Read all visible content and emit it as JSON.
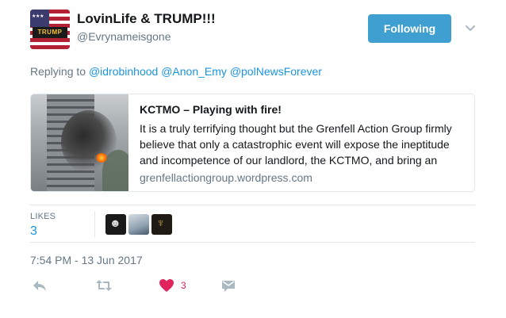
{
  "user": {
    "display_name": "LovinLife & TRUMP!!!",
    "screen_name": "@Evrynameisgone",
    "avatar_text": "TRUMP"
  },
  "follow_button": {
    "label": "Following"
  },
  "reply": {
    "prefix": "Replying to",
    "mentions": [
      "@idrobinhood",
      "@Anon_Emy",
      "@polNewsForever"
    ]
  },
  "card": {
    "title": "KCTMO – Playing with fire!",
    "description": "It is a truly terrifying thought but the Grenfell Action Group firmly believe that only a catastrophic event will expose the ineptitude and incompetence of our landlord, the  KCTMO, and bring an",
    "domain": "grenfellactiongroup.wordpress.com"
  },
  "stats": {
    "likes_label": "LIKES",
    "likes_count": "3"
  },
  "timestamp": "7:54 PM - 13 Jun 2017",
  "actions": {
    "like_count": "3"
  },
  "colors": {
    "accent": "#1b95e0",
    "follow_button_bg": "#3f9fd0",
    "like_red": "#e0245e",
    "muted_text": "#657786",
    "icon_gray": "#aab8c2"
  },
  "icons": [
    "caret-down-icon",
    "reply-icon",
    "retweet-icon",
    "heart-icon",
    "direct-message-icon"
  ]
}
